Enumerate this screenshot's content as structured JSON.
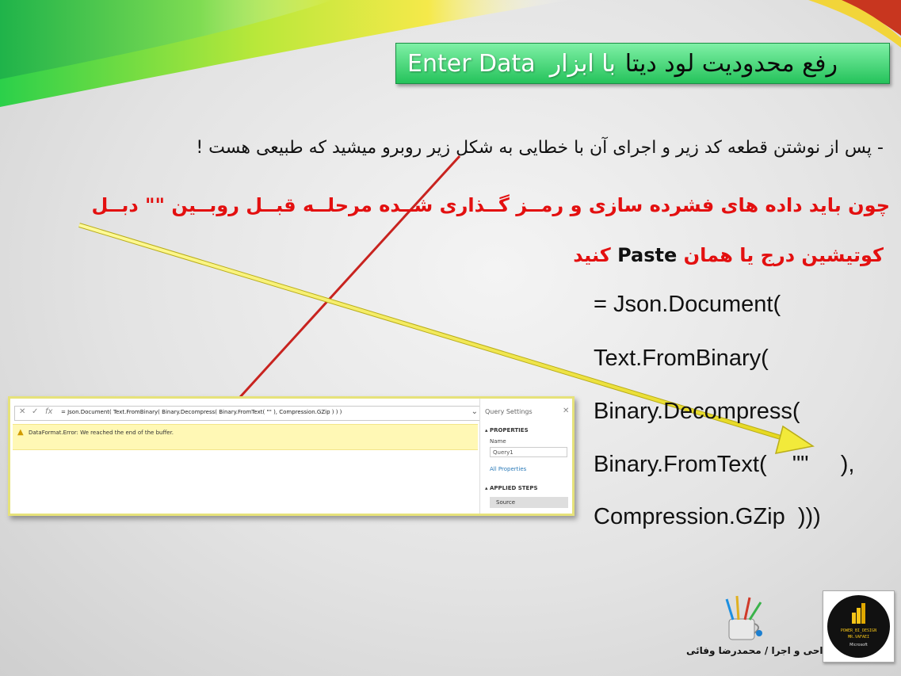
{
  "title": {
    "main": "رفع محدودیت لود دیتا",
    "connector": "با ابزار",
    "tool": "Enter Data"
  },
  "body": {
    "line1": "- پس از نوشتن قطعه کد زیر و اجرای آن با خطایی به شکل زیر روبرو میشید که طبیعی هست !",
    "line2": "چون باید داده های فشرده سازی و رمــز گــذاری شــده مرحلــه قبــل روبــین \"\" دبــل",
    "line3_prefix": "کوتیشین درج یا همان",
    "line3_paste": "Paste",
    "line3_suffix": "کنید"
  },
  "code_lines": [
    "= Json.Document(",
    "Text.FromBinary(",
    "Binary.Decompress(",
    "Binary.FromText(    \"\"     ),",
    "Compression.GZip  )))"
  ],
  "powerquery": {
    "formula": "= Json.Document( Text.FromBinary( Binary.Decompress( Binary.FromText( \"\" ), Compression.GZip ) ) )",
    "fx_label": "fx",
    "error_message": "DataFormat.Error: We reached the end of the buffer.",
    "settings_title": "Query Settings",
    "properties_header": "PROPERTIES",
    "name_label": "Name",
    "name_value": "Query1",
    "all_properties": "All Properties",
    "applied_steps_header": "APPLIED STEPS",
    "step_source": "Source"
  },
  "footer": {
    "credit": "طراحی و اجرا / محمدرضا وفائی",
    "logo_line1": "POWER_BI_DESIGN",
    "logo_line2": "MR.VAFAEI",
    "logo_line3": "Microsoft"
  },
  "colors": {
    "title_green": "#25c35b",
    "emphasis_red": "#e31010",
    "arrow_yellow": "#f2ea3a",
    "arrow_red": "#c8231f"
  }
}
